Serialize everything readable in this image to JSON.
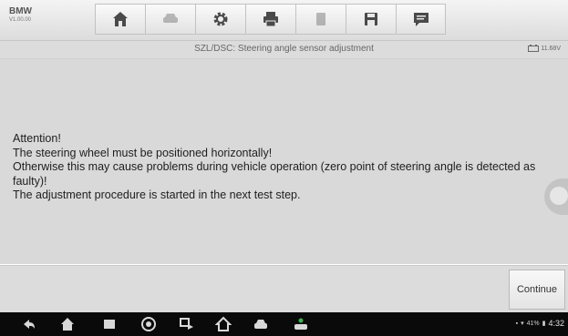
{
  "app": {
    "name": "BMW",
    "version": "V1.00.00"
  },
  "toolbar": {
    "buttons": [
      {
        "name": "home-button",
        "icon": "home-icon"
      },
      {
        "name": "vehicle-swap-button",
        "icon": "vehicle-swap-icon"
      },
      {
        "name": "settings-button",
        "icon": "gear-icon"
      },
      {
        "name": "print-button",
        "icon": "printer-icon"
      },
      {
        "name": "help-button",
        "icon": "help-icon"
      },
      {
        "name": "save-button",
        "icon": "save-icon"
      },
      {
        "name": "data-logging-button",
        "icon": "message-icon"
      }
    ]
  },
  "titlebar": {
    "title": "SZL/DSC: Steering angle sensor adjustment",
    "voltage": "11.68V"
  },
  "message": {
    "lines": [
      "Attention!",
      "The steering wheel must be positioned horizontally!",
      "Otherwise this may cause problems during vehicle operation (zero point of steering angle is detected as faulty)!",
      "The adjustment procedure is started in the next test step."
    ]
  },
  "footer": {
    "continue_label": "Continue"
  },
  "navbar": {
    "icons": [
      "back-icon",
      "home-icon",
      "recent-apps-icon",
      "browser-icon",
      "screenshot-icon",
      "maxisys-home-icon",
      "vci-icon",
      "remote-desk-icon"
    ],
    "status_text": "41%",
    "time": "4:32"
  },
  "colors": {
    "toolbar_bg": "#e6e6e6",
    "content_bg": "#d9d9d9",
    "navbar_bg": "#0a0a0a",
    "toolbar_icon": "#4a4a4a"
  }
}
